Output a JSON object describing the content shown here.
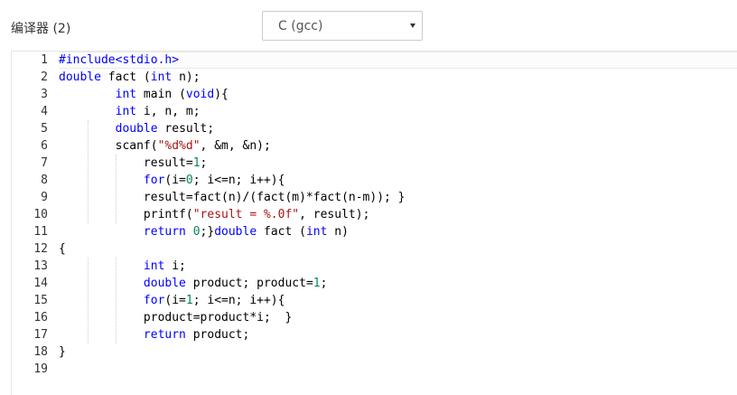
{
  "compiler": {
    "label": "编译器 (2)",
    "selected": "C (gcc)"
  },
  "editor": {
    "line_numbers": [
      "1",
      "2",
      "3",
      "4",
      "5",
      "6",
      "7",
      "8",
      "9",
      "10",
      "11",
      "12",
      "13",
      "14",
      "15",
      "16",
      "17",
      "18",
      "19"
    ],
    "lines": [
      [
        {
          "t": "#include<stdio.h>",
          "c": "inc"
        }
      ],
      [
        {
          "t": "double",
          "c": "kw"
        },
        {
          "t": " fact (",
          "c": ""
        },
        {
          "t": "int",
          "c": "kw"
        },
        {
          "t": " n);",
          "c": ""
        }
      ],
      [
        {
          "t": "        ",
          "c": ""
        },
        {
          "t": "int",
          "c": "kw"
        },
        {
          "t": " main (",
          "c": ""
        },
        {
          "t": "void",
          "c": "kw"
        },
        {
          "t": "){",
          "c": ""
        }
      ],
      [
        {
          "t": "        ",
          "c": ""
        },
        {
          "t": "int",
          "c": "kw"
        },
        {
          "t": " i, n, m;",
          "c": ""
        }
      ],
      [
        {
          "t": "        ",
          "c": ""
        },
        {
          "t": "double",
          "c": "kw"
        },
        {
          "t": " result;",
          "c": ""
        }
      ],
      [
        {
          "t": "        scanf(",
          "c": ""
        },
        {
          "t": "\"%d%d\"",
          "c": "str"
        },
        {
          "t": ", &m, &n);",
          "c": ""
        }
      ],
      [
        {
          "t": "            result=",
          "c": ""
        },
        {
          "t": "1",
          "c": "num"
        },
        {
          "t": ";",
          "c": ""
        }
      ],
      [
        {
          "t": "            ",
          "c": ""
        },
        {
          "t": "for",
          "c": "kw"
        },
        {
          "t": "(i=",
          "c": ""
        },
        {
          "t": "0",
          "c": "num"
        },
        {
          "t": "; i<=n; i++){",
          "c": ""
        }
      ],
      [
        {
          "t": "            result=fact(n)/(fact(m)*fact(n-m)); }",
          "c": ""
        }
      ],
      [
        {
          "t": "            printf(",
          "c": ""
        },
        {
          "t": "\"result = %.0f\"",
          "c": "str"
        },
        {
          "t": ", result);",
          "c": ""
        }
      ],
      [
        {
          "t": "            ",
          "c": ""
        },
        {
          "t": "return",
          "c": "kw"
        },
        {
          "t": " ",
          "c": ""
        },
        {
          "t": "0",
          "c": "num"
        },
        {
          "t": ";}",
          "c": ""
        },
        {
          "t": "double",
          "c": "kw"
        },
        {
          "t": " fact (",
          "c": ""
        },
        {
          "t": "int",
          "c": "kw"
        },
        {
          "t": " n)",
          "c": ""
        }
      ],
      [
        {
          "t": "{",
          "c": ""
        }
      ],
      [
        {
          "t": "            ",
          "c": ""
        },
        {
          "t": "int",
          "c": "kw"
        },
        {
          "t": " i;",
          "c": ""
        }
      ],
      [
        {
          "t": "            ",
          "c": ""
        },
        {
          "t": "double",
          "c": "kw"
        },
        {
          "t": " product; product=",
          "c": ""
        },
        {
          "t": "1",
          "c": "num"
        },
        {
          "t": ";",
          "c": ""
        }
      ],
      [
        {
          "t": "            ",
          "c": ""
        },
        {
          "t": "for",
          "c": "kw"
        },
        {
          "t": "(i=",
          "c": ""
        },
        {
          "t": "1",
          "c": "num"
        },
        {
          "t": "; i<=n; i++){",
          "c": ""
        }
      ],
      [
        {
          "t": "            product=product*i;  }",
          "c": ""
        }
      ],
      [
        {
          "t": "            ",
          "c": ""
        },
        {
          "t": "return",
          "c": "kw"
        },
        {
          "t": " product;",
          "c": ""
        }
      ],
      [
        {
          "t": "}",
          "c": ""
        }
      ],
      [
        {
          "t": "",
          "c": ""
        }
      ]
    ]
  }
}
